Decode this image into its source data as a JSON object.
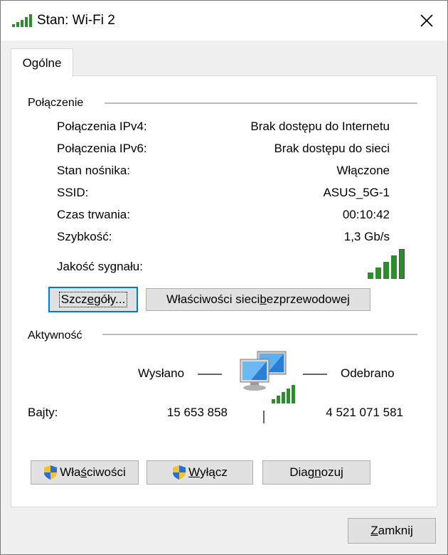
{
  "window": {
    "title": "Stan: Wi-Fi 2"
  },
  "tabs": [
    {
      "label": "Ogólne"
    }
  ],
  "connection": {
    "section_title": "Połączenie",
    "rows": [
      {
        "label": "Połączenia IPv4:",
        "value": "Brak dostępu do Internetu"
      },
      {
        "label": "Połączenia IPv6:",
        "value": "Brak dostępu do sieci"
      },
      {
        "label": "Stan nośnika:",
        "value": "Włączone"
      },
      {
        "label": "SSID:",
        "value": "ASUS_5G-1"
      },
      {
        "label": "Czas trwania:",
        "value": "00:10:42"
      },
      {
        "label": "Szybkość:",
        "value": "1,3 Gb/s"
      }
    ],
    "signal_label": "Jakość sygnału:",
    "signal_bars": 5,
    "signal_color": "#2e8b2e",
    "details_button": {
      "pre": "Szcz",
      "u": "e",
      "post": "góły..."
    },
    "wireless_props_button": {
      "pre": "Właściwości sieci ",
      "u": "b",
      "post": "ezprzewodowej"
    }
  },
  "activity": {
    "section_title": "Aktywność",
    "sent_label": "Wysłano",
    "received_label": "Odebrano",
    "bytes_label": "Bajty:",
    "bytes_sent": "15 653 858",
    "bytes_received": "4 521 071 581"
  },
  "buttons": {
    "properties": {
      "pre": "Wła",
      "u": "ś",
      "post": "ciwości"
    },
    "disable": {
      "pre": "",
      "u": "W",
      "post": "yłącz"
    },
    "diagnose": {
      "pre": "Diag",
      "u": "n",
      "post": "ozuj"
    },
    "close": {
      "pre": "",
      "u": "Z",
      "post": "amknij"
    }
  },
  "icons": {
    "title": "wifi-signal-icon",
    "close": "close-icon",
    "network": "network-computers-icon",
    "shield": "uac-shield-icon"
  },
  "colors": {
    "accent": "#0078d7",
    "signal": "#2e8b2e",
    "monitor": "#2a7fd4"
  }
}
